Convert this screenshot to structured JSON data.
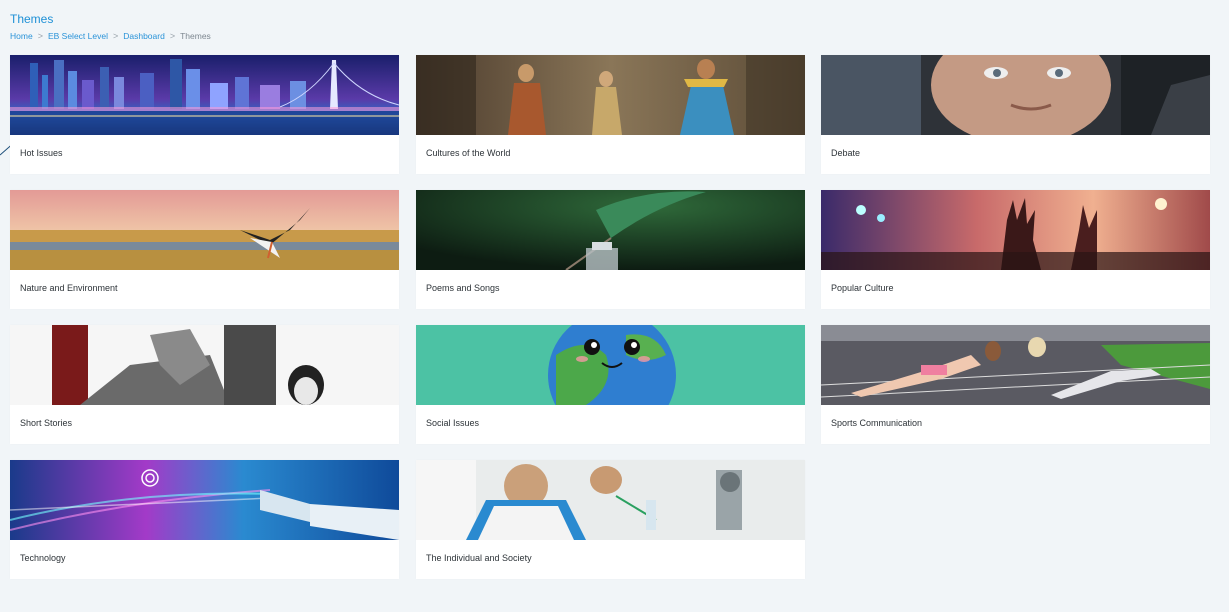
{
  "page": {
    "title": "Themes"
  },
  "breadcrumb": {
    "items": [
      "Home",
      "EB Select Level",
      "Dashboard",
      "Themes"
    ],
    "separator": ">"
  },
  "themes": [
    {
      "label": "Hot Issues",
      "image_icon": "city-skyline-night-image"
    },
    {
      "label": "Cultures of the World",
      "image_icon": "traditional-dancers-image"
    },
    {
      "label": "Debate",
      "image_icon": "speaker-portrait-image"
    },
    {
      "label": "Nature and Environment",
      "image_icon": "stork-in-marsh-image"
    },
    {
      "label": "Poems and Songs",
      "image_icon": "quill-and-inkwell-image"
    },
    {
      "label": "Popular Culture",
      "image_icon": "concert-crowd-hands-image"
    },
    {
      "label": "Short Stories",
      "image_icon": "detective-sketch-image"
    },
    {
      "label": "Social Issues",
      "image_icon": "cartoon-earth-image"
    },
    {
      "label": "Sports Communication",
      "image_icon": "track-workout-image"
    },
    {
      "label": "Technology",
      "image_icon": "fiber-optic-cable-image"
    },
    {
      "label": "The Individual and Society",
      "image_icon": "students-in-lab-image"
    }
  ],
  "colors": {
    "accent": "#1e90d6",
    "background": "#f1f5f8",
    "card": "#ffffff",
    "label": "#2d3338"
  }
}
